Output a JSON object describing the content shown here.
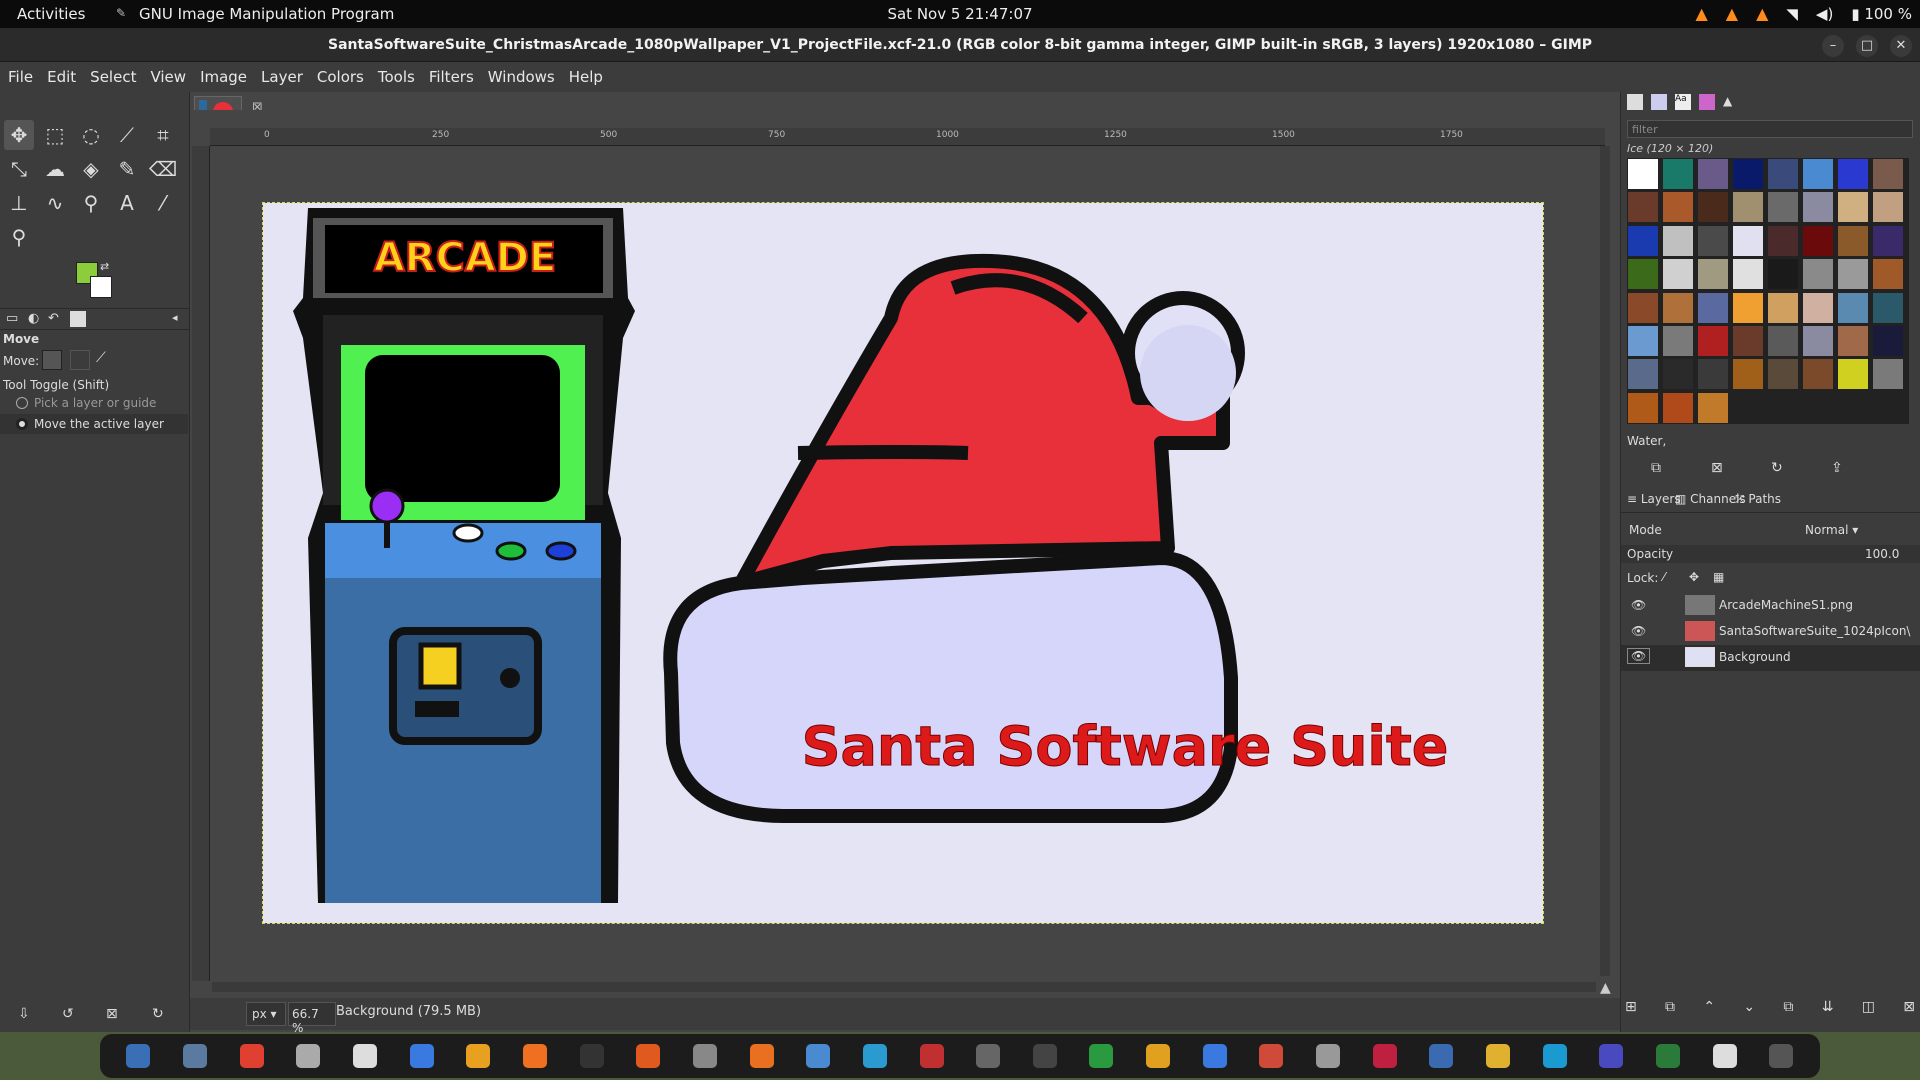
{
  "topbar": {
    "activities": "Activities",
    "app_name": "GNU Image Manipulation Program",
    "clock": "Sat Nov 5  21:47:07",
    "battery": "100 %"
  },
  "window": {
    "title": "SantaSoftwareSuite_ChristmasArcade_1080pWallpaper_V1_ProjectFile.xcf-21.0 (RGB color 8-bit gamma integer, GIMP built-in sRGB, 3 layers) 1920x1080 – GIMP"
  },
  "menu": [
    "File",
    "Edit",
    "Select",
    "View",
    "Image",
    "Layer",
    "Colors",
    "Tools",
    "Filters",
    "Windows",
    "Help"
  ],
  "ruler": {
    "ticks": [
      "0",
      "250",
      "500",
      "750",
      "1000",
      "1250",
      "1500",
      "1750"
    ]
  },
  "tool_options": {
    "title": "Move",
    "move_label": "Move:",
    "toggle_label": "Tool Toggle  (Shift)",
    "opt1": "Pick a layer or guide",
    "opt2": "Move the active layer"
  },
  "canvas": {
    "arcade_marquee": "ARCADE",
    "banner_text": "Santa Software Suite"
  },
  "status": {
    "unit": "px",
    "zoom": "66.7 %",
    "info": "Background (79.5 MB)"
  },
  "patterns": {
    "filter_placeholder": "filter",
    "label": "Ice (120 × 120)",
    "tag": "Water,"
  },
  "layers_panel": {
    "tabs": [
      "Layers",
      "Channels",
      "Paths"
    ],
    "mode_label": "Mode",
    "mode_value": "Normal",
    "opacity_label": "Opacity",
    "opacity_value": "100.0",
    "lock_label": "Lock:",
    "layers": [
      {
        "name": "ArcadeMachineS1.png"
      },
      {
        "name": "SantaSoftwareSuite_1024pIcon\\"
      },
      {
        "name": "Background"
      }
    ]
  },
  "colors": {
    "fg": "#8ccd3c",
    "bg": "#ffffff",
    "hat_red": "#e8303a",
    "title_red": "#dd1a1a"
  }
}
